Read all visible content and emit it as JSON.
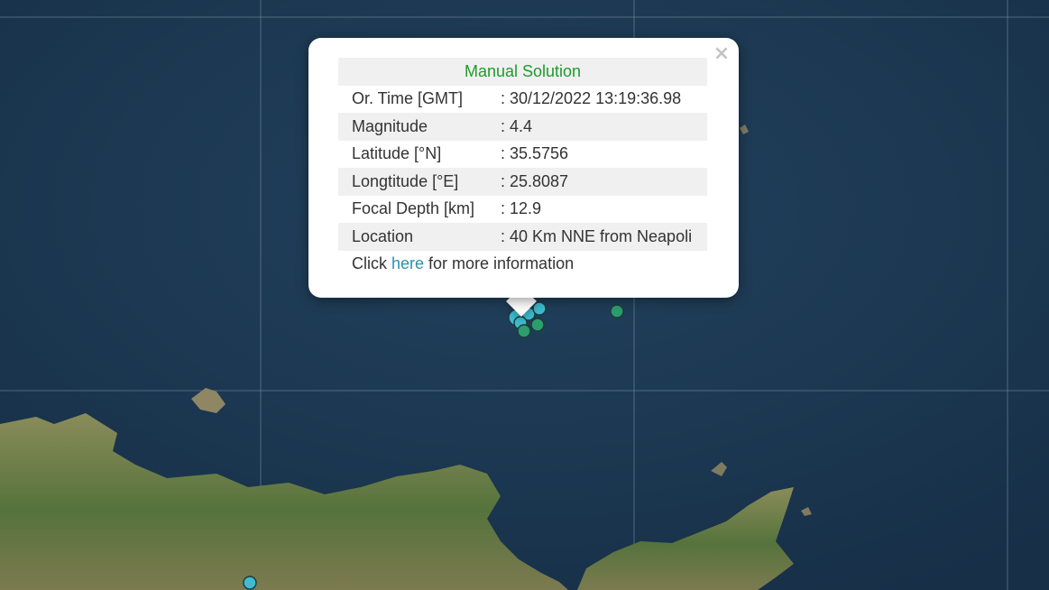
{
  "popup": {
    "close_label": "×",
    "title": "Manual Solution",
    "rows": [
      {
        "label": "Or. Time [GMT]",
        "value": ": 30/12/2022 13:19:36.98"
      },
      {
        "label": "Magnitude",
        "value": ": 4.4"
      },
      {
        "label": "Latitude [°N]",
        "value": ": 35.5756"
      },
      {
        "label": "Longtitude [°E]",
        "value": ": 25.8087"
      },
      {
        "label": "Focal Depth [km]",
        "value": ": 12.9"
      },
      {
        "label": "Location",
        "value": ": 40 Km NNE from Neapoli"
      }
    ],
    "more_prefix": "Click ",
    "more_link": "here",
    "more_suffix": " for more information"
  },
  "colors": {
    "sea": "#1c3a55",
    "land": "#6f7d48",
    "marker_cyan": "#3fbcd0",
    "marker_green": "#2c9d6c",
    "title_green": "#1f9a2c",
    "link": "#2b8fb5"
  },
  "markers": [
    {
      "type": "event",
      "color": "cyan"
    },
    {
      "type": "event",
      "color": "cyan"
    },
    {
      "type": "event",
      "color": "cyan"
    },
    {
      "type": "event",
      "color": "cyan"
    },
    {
      "type": "event",
      "color": "green"
    },
    {
      "type": "event",
      "color": "green"
    },
    {
      "type": "event",
      "color": "green"
    },
    {
      "type": "event",
      "color": "cyan"
    }
  ]
}
